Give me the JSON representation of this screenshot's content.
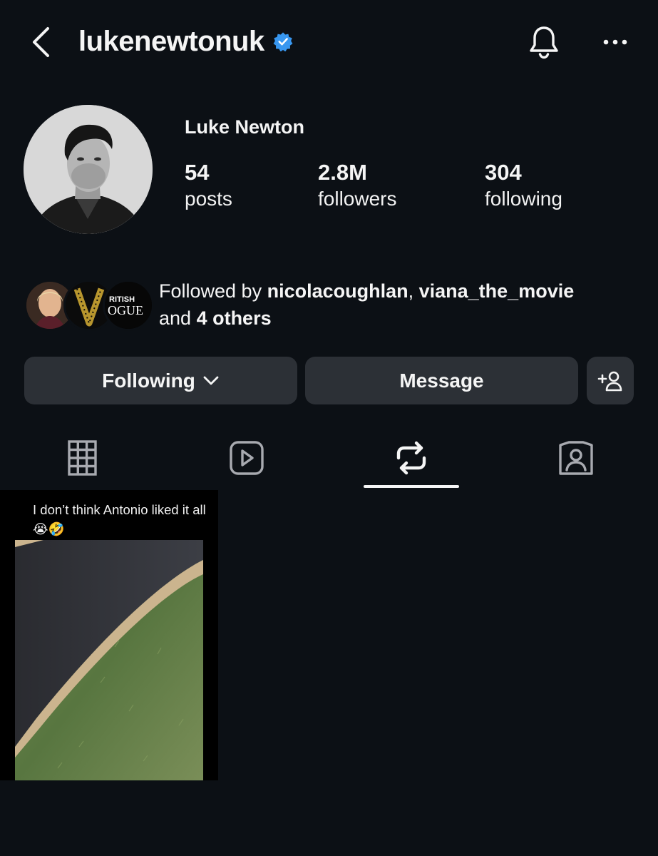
{
  "header": {
    "username": "lukenewtonuk",
    "icons": {
      "back": "chevron-left-icon",
      "verified": "verified-badge-icon",
      "notifications": "bell-icon",
      "more": "more-horizontal-icon"
    }
  },
  "profile": {
    "display_name": "Luke Newton",
    "stats": {
      "posts": {
        "value": "54",
        "label": "posts"
      },
      "followers": {
        "value": "2.8M",
        "label": "followers"
      },
      "following": {
        "value": "304",
        "label": "following"
      }
    },
    "followed_by": {
      "prefix": "Followed by ",
      "user1": "nicolacoughlan",
      "separator": ", ",
      "user2": "viana_the_movie",
      "and": "and ",
      "others": "4 others",
      "mutual_avatar_3_text": "RITISH\nOGUE"
    }
  },
  "actions": {
    "following_label": "Following",
    "message_label": "Message"
  },
  "tabs": [
    {
      "name": "grid",
      "icon": "grid-icon",
      "active": false
    },
    {
      "name": "reels",
      "icon": "reels-icon",
      "active": false
    },
    {
      "name": "reposts",
      "icon": "repost-icon",
      "active": true
    },
    {
      "name": "tagged",
      "icon": "tagged-icon",
      "active": false
    }
  ],
  "reposts": [
    {
      "caption": "I don’t think Antonio liked it all 😭🤣"
    }
  ],
  "colors": {
    "background": "#0c1015",
    "button": "#2c3036",
    "verified": "#3897f0",
    "text": "#f5f5f5"
  }
}
